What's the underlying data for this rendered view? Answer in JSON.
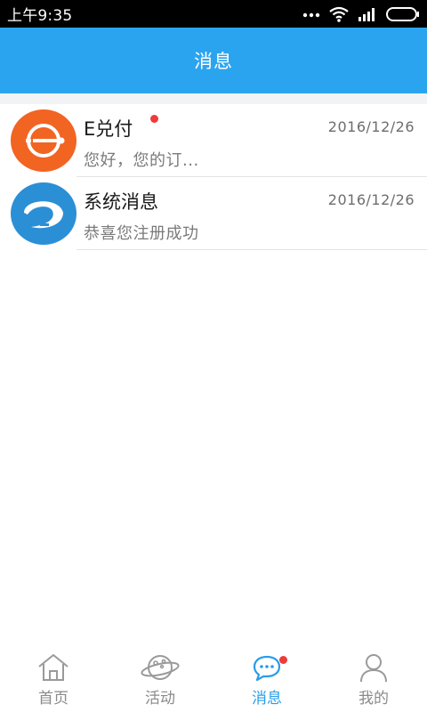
{
  "status_bar": {
    "time": "上午9:35",
    "icons": [
      "more-dots-icon",
      "wifi-icon",
      "signal-icon",
      "battery-icon"
    ]
  },
  "header": {
    "title": "消息"
  },
  "messages": [
    {
      "title": "E兑付",
      "date": "2016/12/26",
      "preview": "您好，您的订...",
      "avatar_icon": "e-duifu-logo-icon",
      "avatar_color": "#f26422",
      "unread": true
    },
    {
      "title": "系统消息",
      "date": "2016/12/26",
      "preview": "恭喜您注册成功",
      "avatar_icon": "system-logo-icon",
      "avatar_color": "#2b8fd6",
      "unread": false
    }
  ],
  "bottom_nav": {
    "items": [
      {
        "label": "首页",
        "icon": "home-icon",
        "active": false
      },
      {
        "label": "活动",
        "icon": "planet-icon",
        "active": false
      },
      {
        "label": "消息",
        "icon": "chat-bubble-icon",
        "active": true,
        "badge": true
      },
      {
        "label": "我的",
        "icon": "person-icon",
        "active": false
      }
    ]
  },
  "colors": {
    "header_bg": "#2ba4f0",
    "active_tab": "#2a9de8",
    "inactive_tab": "#8a8a8a",
    "badge": "#f03a3a"
  }
}
